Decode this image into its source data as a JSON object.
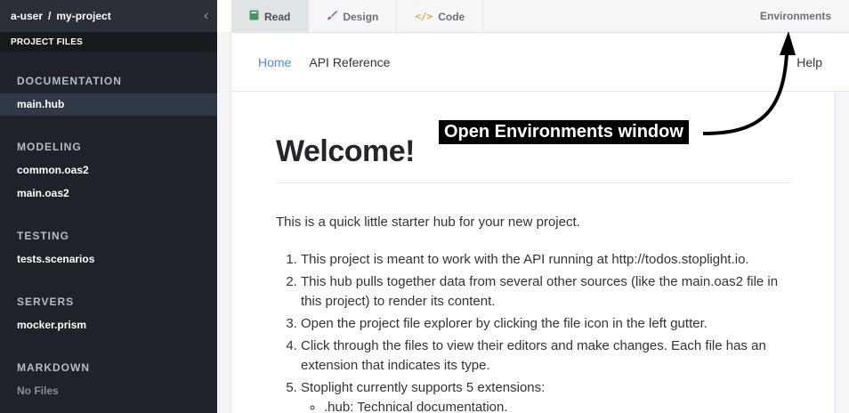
{
  "sidebar": {
    "user": "a-user",
    "separator": "/",
    "project": "my-project",
    "files_header": "PROJECT FILES",
    "sections": [
      {
        "title": "DOCUMENTATION",
        "items": [
          {
            "label": "main.hub",
            "active": true
          }
        ]
      },
      {
        "title": "MODELING",
        "items": [
          {
            "label": "common.oas2"
          },
          {
            "label": "main.oas2"
          }
        ]
      },
      {
        "title": "TESTING",
        "items": [
          {
            "label": "tests.scenarios"
          }
        ]
      },
      {
        "title": "SERVERS",
        "items": [
          {
            "label": "mocker.prism"
          }
        ]
      },
      {
        "title": "MARKDOWN",
        "items": [
          {
            "label": "No Files",
            "muted": true
          }
        ]
      }
    ]
  },
  "tabs": [
    {
      "label": "Read",
      "icon": "book-icon",
      "active": true
    },
    {
      "label": "Design",
      "icon": "brush-icon"
    },
    {
      "label": "Code",
      "icon": "code-icon"
    }
  ],
  "environments_label": "Environments",
  "hubnav": {
    "home": "Home",
    "api": "API Reference",
    "help": "Help"
  },
  "content": {
    "title": "Welcome!",
    "intro": "This is a quick little starter hub for your new project.",
    "steps": [
      "This project is meant to work with the API running at http://todos.stoplight.io.",
      "This hub pulls together data from several other sources (like the main.oas2 file in this project) to render its content.",
      "Open the project file explorer by clicking the file icon in the left gutter.",
      "Click through the files to view their editors and make changes. Each file has an extension that indicates its type.",
      "Stoplight currently supports 5 extensions:"
    ],
    "sub_items": [
      ".hub: Technical documentation."
    ]
  },
  "annotation": {
    "text": "Open Environments window"
  },
  "colors": {
    "sidebar_bg": "#1f2329",
    "link_blue": "#4a8fe0",
    "design_icon": "#b03bd1",
    "code_icon": "#f0a030",
    "read_icon": "#3f9b57"
  }
}
